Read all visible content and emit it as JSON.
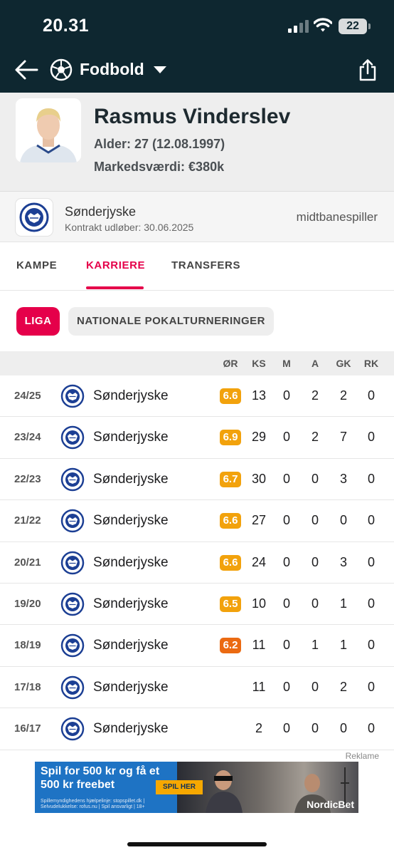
{
  "status_bar": {
    "time": "20.31",
    "battery": "22"
  },
  "header": {
    "title": "Fodbold"
  },
  "player": {
    "name": "Rasmus Vinderslev",
    "age_line": "Alder: 27 (12.08.1997)",
    "value_line": "Markedsværdi: €380k"
  },
  "club": {
    "name": "Sønderjyske",
    "contract": "Kontrakt udløber: 30.06.2025",
    "position": "midtbanespiller"
  },
  "tabs": [
    {
      "label": "KAMPE"
    },
    {
      "label": "KARRIERE"
    },
    {
      "label": "TRANSFERS"
    }
  ],
  "filters": {
    "active": "LIGA",
    "other": "NATIONALE POKALTURNERINGER"
  },
  "table": {
    "columns": [
      "ØR",
      "KS",
      "M",
      "A",
      "GK",
      "RK"
    ],
    "rows": [
      {
        "season": "24/25",
        "team": "Sønderjyske",
        "rating": "6.6",
        "ks": "13",
        "m": "0",
        "a": "2",
        "gk": "2",
        "rk": "0"
      },
      {
        "season": "23/24",
        "team": "Sønderjyske",
        "rating": "6.9",
        "ks": "29",
        "m": "0",
        "a": "2",
        "gk": "7",
        "rk": "0"
      },
      {
        "season": "22/23",
        "team": "Sønderjyske",
        "rating": "6.7",
        "ks": "30",
        "m": "0",
        "a": "0",
        "gk": "3",
        "rk": "0"
      },
      {
        "season": "21/22",
        "team": "Sønderjyske",
        "rating": "6.6",
        "ks": "27",
        "m": "0",
        "a": "0",
        "gk": "0",
        "rk": "0"
      },
      {
        "season": "20/21",
        "team": "Sønderjyske",
        "rating": "6.6",
        "ks": "24",
        "m": "0",
        "a": "0",
        "gk": "3",
        "rk": "0"
      },
      {
        "season": "19/20",
        "team": "Sønderjyske",
        "rating": "6.5",
        "ks": "10",
        "m": "0",
        "a": "0",
        "gk": "1",
        "rk": "0"
      },
      {
        "season": "18/19",
        "team": "Sønderjyske",
        "rating": "6.2",
        "ks": "11",
        "m": "0",
        "a": "1",
        "gk": "1",
        "rk": "0"
      },
      {
        "season": "17/18",
        "team": "Sønderjyske",
        "rating": "",
        "ks": "11",
        "m": "0",
        "a": "0",
        "gk": "2",
        "rk": "0"
      },
      {
        "season": "16/17",
        "team": "Sønderjyske",
        "rating": "",
        "ks": "2",
        "m": "0",
        "a": "0",
        "gk": "0",
        "rk": "0"
      }
    ]
  },
  "ad": {
    "label": "Reklame",
    "headline": "Spil for 500 kr og få et 500 kr freebet",
    "cta": "SPIL HER",
    "brand": "NordicBet",
    "fine_print": "Spillemyndighedens hjælpelinje: stopspillet.dk | Selvudelukkelse: rofus.nu | Spil ansvarligt | 18+"
  },
  "colors": {
    "header_bg": "#0e2730",
    "accent": "#e5004a",
    "rating_orange": "#f2a20c",
    "rating_low": "#eb6a12",
    "club_blue": "#1c3f94"
  },
  "icons": [
    "back-arrow-icon",
    "football-icon",
    "caret-down-icon",
    "share-icon",
    "club-crest-icon"
  ]
}
